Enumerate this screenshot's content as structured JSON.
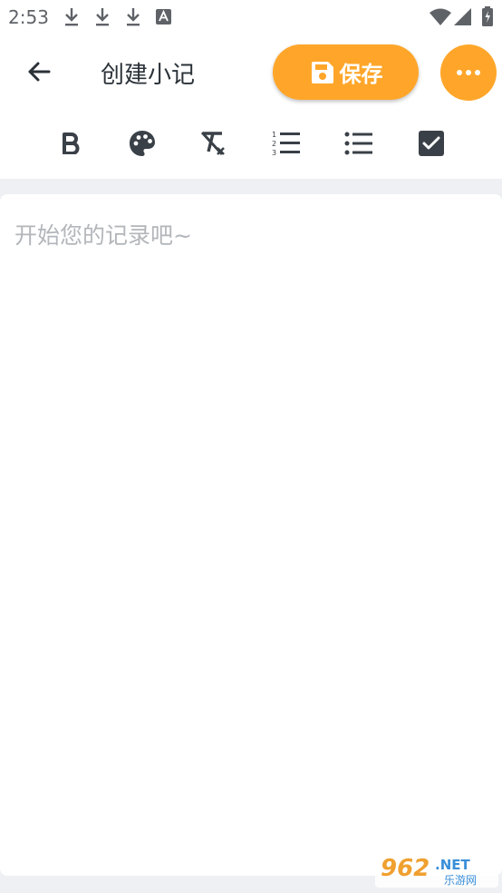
{
  "status_bar": {
    "time": "2:53",
    "icons": [
      "download-icon",
      "download-icon",
      "download-icon",
      "a-icon",
      "wifi-icon",
      "signal-icon",
      "battery-charging-icon"
    ]
  },
  "header": {
    "title": "创建小记",
    "save_label": "保存",
    "accent_color": "#ffa62a"
  },
  "toolbar": {
    "tools": [
      "bold-icon",
      "palette-icon",
      "clear-format-icon",
      "numbered-list-icon",
      "bulleted-list-icon",
      "checkbox-icon"
    ]
  },
  "editor": {
    "placeholder": "开始您的记录吧~"
  },
  "watermark": {
    "brand": "962.NET",
    "sub": "乐游网"
  }
}
